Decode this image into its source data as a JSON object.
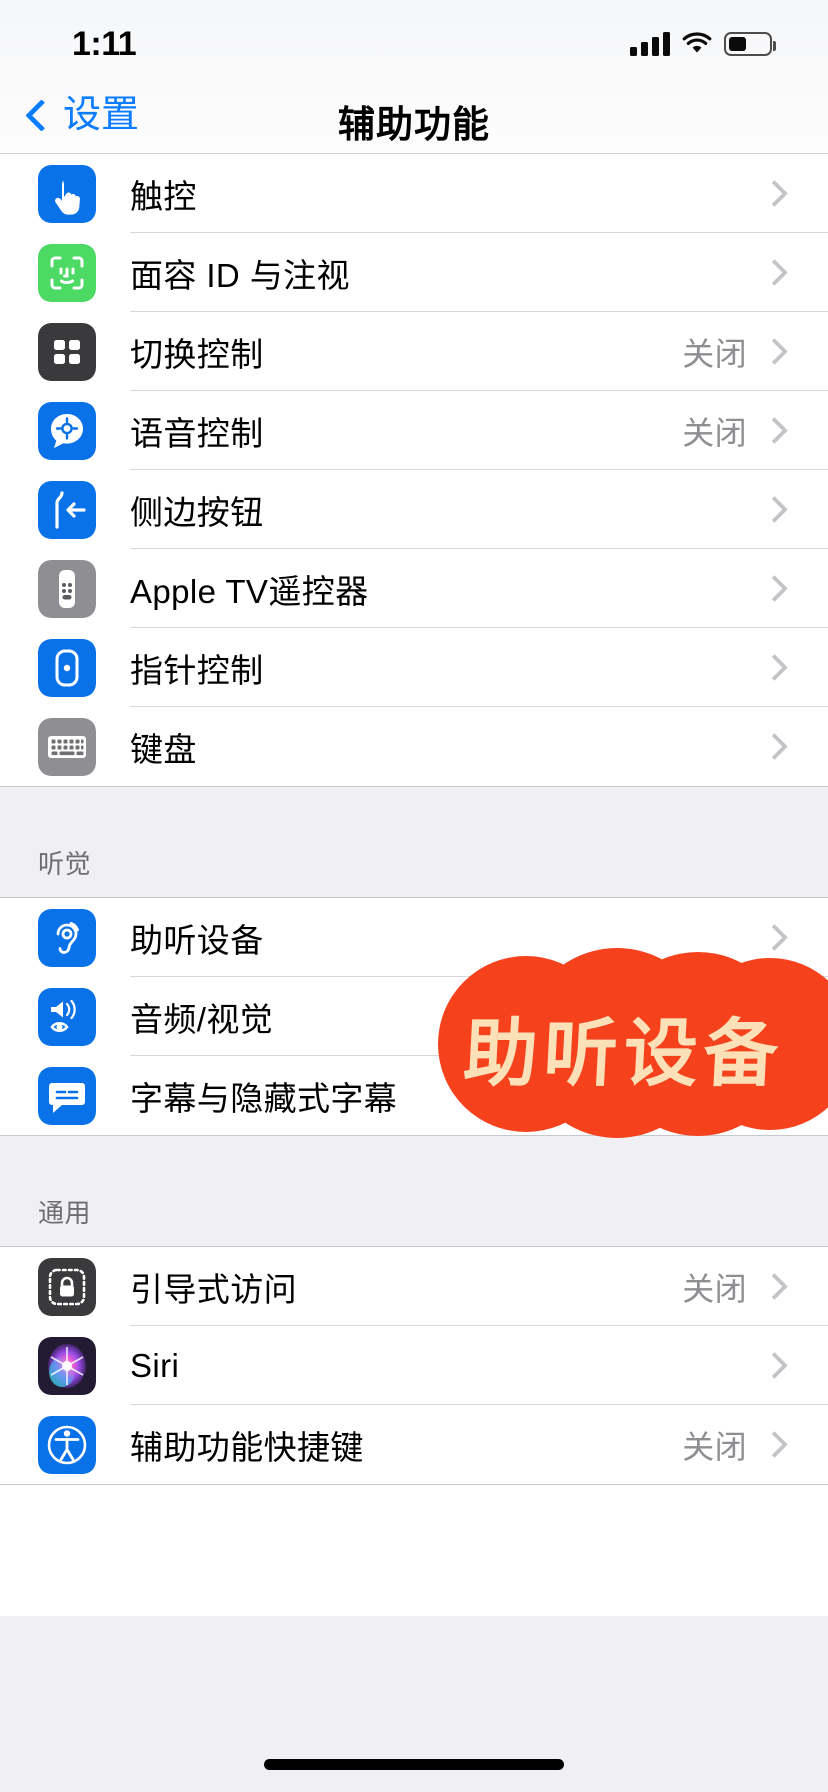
{
  "status_bar": {
    "time": "1:11",
    "signal_icon": "cellular-bars-icon",
    "signal_bars_filled": 4,
    "wifi_icon": "wifi-icon",
    "battery_icon": "battery-icon",
    "battery_level_percent": 40
  },
  "nav": {
    "back_label": "设置",
    "back_icon": "chevron-left-icon",
    "title": "辅助功能"
  },
  "colors": {
    "accent_blue": "#0A7CFF",
    "icon_blue": "#0A72E8",
    "icon_green": "#4CD964",
    "icon_gray": "#8E8E93",
    "icon_dark": "#3A3A3C",
    "value_gray": "#8E8E93",
    "chevron_gray": "#C4C4C8",
    "group_bg": "#EFEFF4",
    "sticker_fill": "#F5421C",
    "sticker_text": "#FBE0B8"
  },
  "sections": [
    {
      "header": "",
      "rows": [
        {
          "label": "触控",
          "value": "",
          "icon": "hand-touch-icon",
          "icon_style": "blue"
        },
        {
          "label": "面容 ID 与注视",
          "value": "",
          "icon": "face-id-icon",
          "icon_style": "green"
        },
        {
          "label": "切换控制",
          "value": "关闭",
          "icon": "switch-control-grid-icon",
          "icon_style": "dark"
        },
        {
          "label": "语音控制",
          "value": "关闭",
          "icon": "voice-control-bubble-icon",
          "icon_style": "blue"
        },
        {
          "label": "侧边按钮",
          "value": "",
          "icon": "side-button-icon",
          "icon_style": "blue"
        },
        {
          "label": "Apple TV遥控器",
          "value": "",
          "icon": "apple-tv-remote-icon",
          "icon_style": "gray"
        },
        {
          "label": "指针控制",
          "value": "",
          "icon": "pointer-control-icon",
          "icon_style": "blue"
        },
        {
          "label": "键盘",
          "value": "",
          "icon": "keyboard-icon",
          "icon_style": "gray"
        }
      ]
    },
    {
      "header": "听觉",
      "rows": [
        {
          "label": "助听设备",
          "value": "",
          "icon": "ear-hearing-icon",
          "icon_style": "blue"
        },
        {
          "label": "音频/视觉",
          "value": "",
          "icon": "audio-visual-icon",
          "icon_style": "blue"
        },
        {
          "label": "字幕与隐藏式字幕",
          "value": "",
          "icon": "captions-icon",
          "icon_style": "blue"
        }
      ]
    },
    {
      "header": "通用",
      "rows": [
        {
          "label": "引导式访问",
          "value": "关闭",
          "icon": "guided-access-lock-icon",
          "icon_style": "dark"
        },
        {
          "label": "Siri",
          "value": "",
          "icon": "siri-orb-icon",
          "icon_style": "siri"
        },
        {
          "label": "辅助功能快捷键",
          "value": "关闭",
          "icon": "accessibility-person-icon",
          "icon_style": "blue"
        }
      ]
    }
  ],
  "annotation": {
    "text": "助听设备",
    "shape": "cloud-blob-sticker"
  },
  "home_indicator": "home-indicator-bar"
}
